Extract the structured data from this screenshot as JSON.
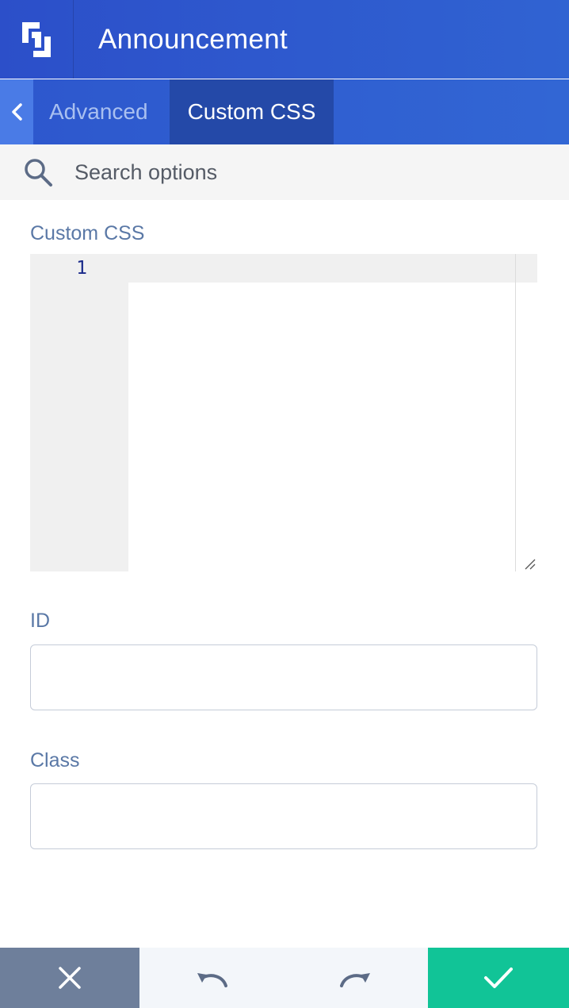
{
  "header": {
    "title": "Announcement",
    "logo_icon": "brand-logo-icon",
    "background": "#2c4fc9"
  },
  "tabs": {
    "back_icon": "chevron-left-icon",
    "items": [
      {
        "label": "Advanced",
        "active": false
      },
      {
        "label": "Custom CSS",
        "active": true
      }
    ]
  },
  "search": {
    "placeholder": "Search options",
    "value": "",
    "icon": "search-icon"
  },
  "fields": {
    "custom_css": {
      "label": "Custom CSS",
      "line_numbers": [
        "1"
      ],
      "value": ""
    },
    "id": {
      "label": "ID",
      "value": ""
    },
    "class": {
      "label": "Class",
      "value": ""
    }
  },
  "footer": {
    "cancel_icon": "close-icon",
    "undo_icon": "undo-icon",
    "redo_icon": "redo-icon",
    "save_icon": "checkmark-icon",
    "cancel_color": "#6e7f9b",
    "save_color": "#11c497"
  }
}
